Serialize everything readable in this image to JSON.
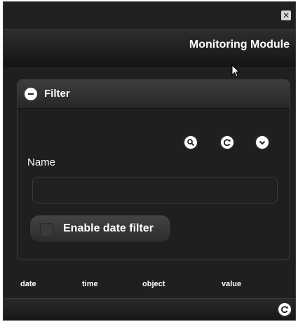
{
  "window": {
    "close_icon": "close-icon",
    "title": "Monitoring Module"
  },
  "filter": {
    "header_label": "Filter",
    "collapse_icon": "minus-circle-icon",
    "actions": [
      {
        "icon": "search-icon"
      },
      {
        "icon": "refresh-icon"
      },
      {
        "icon": "chevron-down-icon"
      }
    ],
    "name_label": "Name",
    "name_value": "",
    "name_placeholder": "",
    "date_filter_label": "Enable date filter",
    "date_filter_checked": false
  },
  "table": {
    "columns": [
      "date",
      "time",
      "object",
      "value"
    ]
  },
  "footer": {
    "refresh_icon": "refresh-icon"
  },
  "colors": {
    "background": "#1f1f1f",
    "text": "#ffffff",
    "icon_fill": "#ffffff"
  }
}
